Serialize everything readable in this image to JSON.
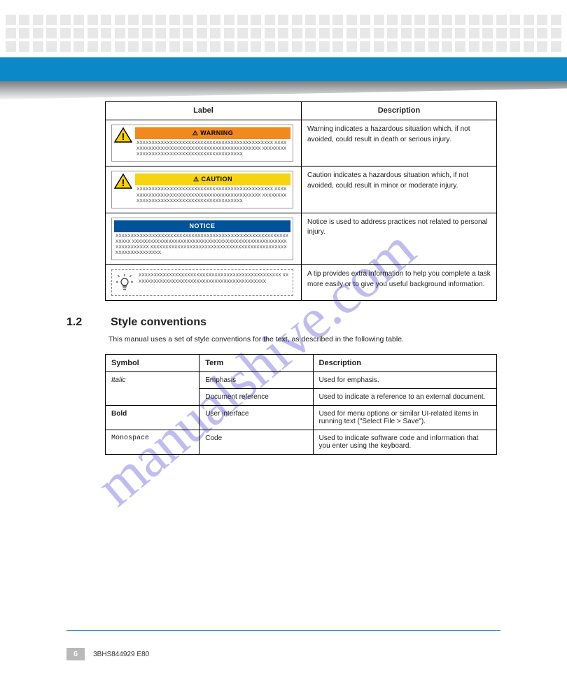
{
  "watermark": "manualshive.com",
  "table1": {
    "headers": [
      "Label",
      "Description"
    ],
    "rows": [
      {
        "type": "warning",
        "header_text": "WARNING",
        "sample": "XXXXXXXXXXXXXXXXXXXXXXXXXXXXXXXXXXXXXXXXXXXXX XXXXXXXXXXXXXXXXXXXXXXXXXXXXXXXXXXXXXXXXXXXXX XXXXXXXXXXXXXXXXXXXXXXXXXXXXXXXXXXXXXXXXXXX",
        "desc": "Warning indicates a hazardous situation which, if not avoided, could result in death or serious injury."
      },
      {
        "type": "caution",
        "header_text": "CAUTION",
        "sample": "XXXXXXXXXXXXXXXXXXXXXXXXXXXXXXXXXXXXXXXXXXXXX XXXXXXXXXXXXXXXXXXXXXXXXXXXXXXXXXXXXXXXXXXXXX XXXXXXXXXXXXXXXXXXXXXXXXXXXXXXXXXXXXXXXXXXX",
        "desc": "Caution indicates a hazardous situation which, if not avoided, could result in minor or moderate injury."
      },
      {
        "type": "notice",
        "header_text": "NOTICE",
        "sample": "XXXXXXXXXXXXXXXXXXXXXXXXXXXXXXXXXXXXXXXXXXXXXXXXXXXXXXXXXXXXXX XXXXXXXXXXXXXXXXXXXXXXXXXXXXXXXXXXXXXXXXXXXXXXXXXXXXXXXXXXXXXX XXXXXXXXXXXXXXXXXXXXXXXXXXXXXXXXXXXXXXXXXXXXXXXXXXXXXXXXXXXX",
        "desc": "Notice is used to address practices not related to personal injury."
      },
      {
        "type": "tip",
        "sample": "XXXXXXXXXXXXXXXXXXXXXXXXXXXXXXXXXXXXXXXXXXXXXXX XXXXXXXXXXXXXXXXXXXXXXXXXXXXXXXXXXXXXXXXXXXX",
        "desc": "A tip provides extra information to help you complete a task more easily or to give you useful background information."
      }
    ]
  },
  "section2": {
    "num": "1.2",
    "title": "Style conventions",
    "intro": "This manual uses a set of style conventions for the text, as described in the following table.",
    "headers": [
      "Symbol",
      "Term",
      "Description"
    ],
    "rows": [
      {
        "sym": "Italic",
        "sym_style": "italic",
        "term": "Emphasis",
        "desc": "Used for emphasis."
      },
      {
        "sym": "",
        "sym_style": "",
        "term": "Document reference",
        "desc": "Used to indicate a reference to an external document."
      },
      {
        "sym": "Bold",
        "sym_style": "bold",
        "term": "User interface",
        "desc": "Used for menu options or similar UI-related items in running text (\"Select File > Save\")."
      },
      {
        "sym": "Monospace",
        "sym_style": "mono",
        "term": "Code",
        "desc": "Used to indicate software code and information that you enter using the keyboard."
      }
    ]
  },
  "footer": {
    "page": "6",
    "doc": "3BHS844929 E80"
  }
}
